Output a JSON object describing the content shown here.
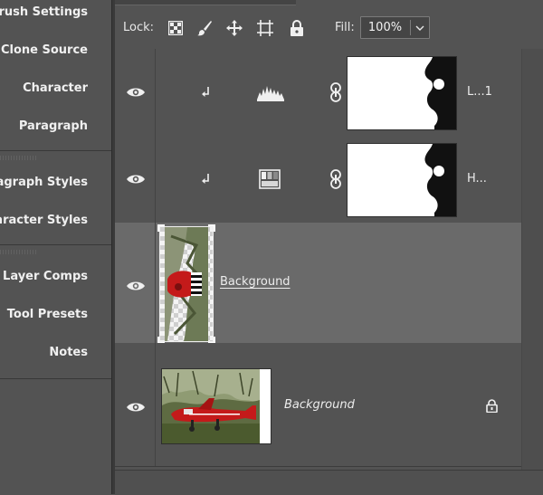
{
  "left_dock": {
    "items": [
      {
        "label": "Brush Settings"
      },
      {
        "label": "Clone Source"
      },
      {
        "label": "Character"
      },
      {
        "label": "Paragraph"
      },
      {
        "label": "Paragraph Styles"
      },
      {
        "label": "Character Styles"
      },
      {
        "label": "Layer Comps"
      },
      {
        "label": "Tool Presets"
      },
      {
        "label": "Notes"
      }
    ]
  },
  "lock_bar": {
    "lock_label": "Lock:",
    "icons": [
      "lock-transparent-pixels-icon",
      "lock-image-pixels-icon",
      "lock-position-icon",
      "lock-artboard-icon",
      "lock-all-icon"
    ],
    "fill_label": "Fill:",
    "fill_value": "100%"
  },
  "layers": [
    {
      "name": "L...1",
      "type": "adjustment",
      "adjustment_icon": "levels-icon",
      "clipped": true,
      "linked_mask": true,
      "visible": true
    },
    {
      "name": "H...",
      "type": "adjustment",
      "adjustment_icon": "hue-saturation-icon",
      "clipped": true,
      "linked_mask": true,
      "visible": true
    },
    {
      "name": "Background",
      "type": "pixel",
      "selected": true,
      "visible": true
    },
    {
      "name": "Background",
      "type": "background",
      "locked": true,
      "visible": true
    }
  ],
  "colors": {
    "panel_bg": "#535353",
    "selected_row": "#6a6a6a",
    "text": "#e8e8e8",
    "plane_red": "#c41a1a"
  }
}
